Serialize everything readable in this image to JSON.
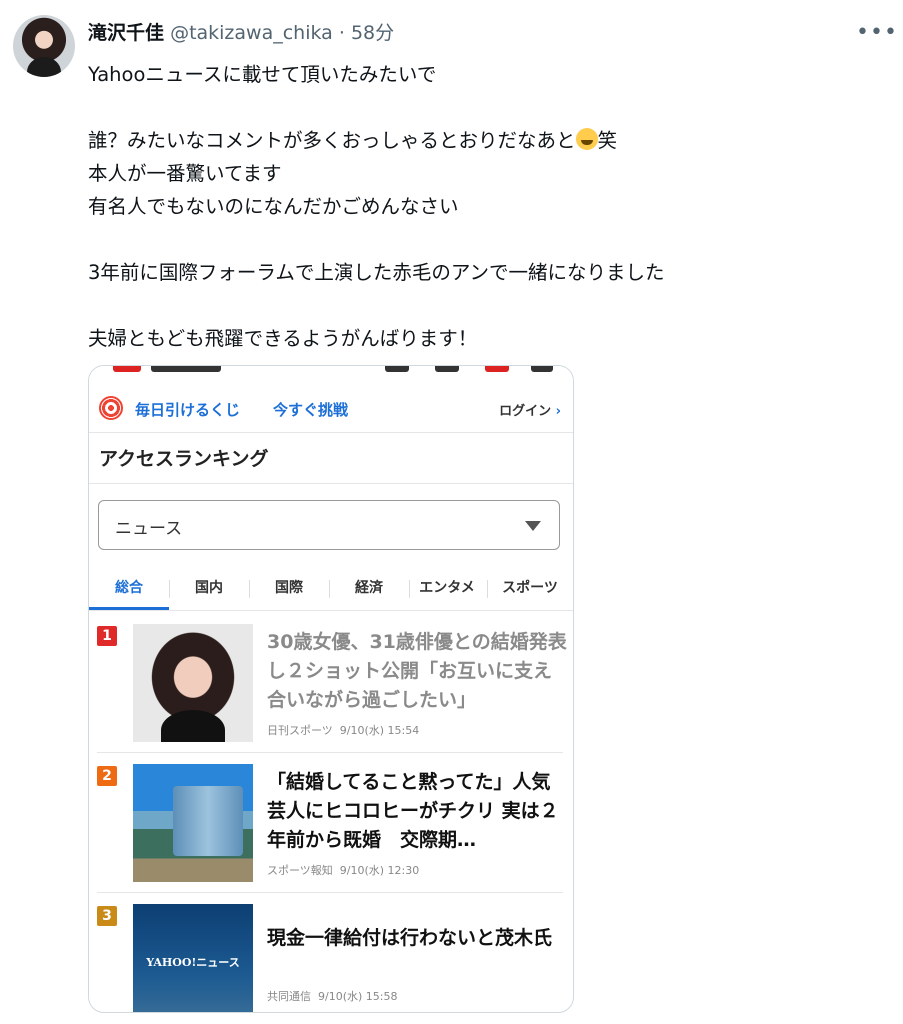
{
  "tweet": {
    "display_name": "滝沢千佳",
    "handle": "@takizawa_chika",
    "separator": "·",
    "time_ago": "58分",
    "more_icon": "more-horizontal-icon",
    "lines": [
      "Yahooニュースに載せて頂いたみたいで",
      "",
      "誰？みたいなコメントが多くおっしゃるとおりだなあと",
      "本人が一番驚いてます",
      "有名人でもないのになんだかごめんなさい",
      "",
      "3年前に国際フォーラムで上演した赤毛のアンで一緒になりました",
      "",
      "夫婦ともども飛躍できるようがんばります！"
    ],
    "emoji_after_line_3": "rolling-on-floor-laughing-emoji",
    "line3_suffix": "笑"
  },
  "embedded": {
    "lottery_label": "毎日引けるくじ",
    "lottery_cta": "今すぐ挑戦",
    "login": "ログイン",
    "section_title": "アクセスランキング",
    "category_select": "ニュース",
    "tabs": [
      "総合",
      "国内",
      "国際",
      "経済",
      "エンタメ",
      "スポーツ"
    ],
    "active_tab": "総合",
    "ranking": [
      {
        "rank": "1",
        "headline": "30歳女優、31歳俳優との結婚発表し２ショット公開「お互いに支え合いながら過ごしたい」",
        "source": "日刊スポーツ",
        "date": "9/10(水) 15:54",
        "badge_color": "#e02a2a",
        "visited": true
      },
      {
        "rank": "2",
        "headline": "「結婚してること黙ってた」人気芸人にヒコロヒーがチクリ 実は２年前から既婚　交際期…",
        "source": "スポーツ報知",
        "date": "9/10(水) 12:30",
        "badge_color": "#ee6a13",
        "visited": false
      },
      {
        "rank": "3",
        "headline": "現金一律給付は行わないと茂木氏",
        "source": "共同通信",
        "date": "9/10(水) 15:58",
        "badge_color": "#c98a18",
        "visited": false
      }
    ],
    "thumb3_logo": "YAHOO!ニュース"
  }
}
